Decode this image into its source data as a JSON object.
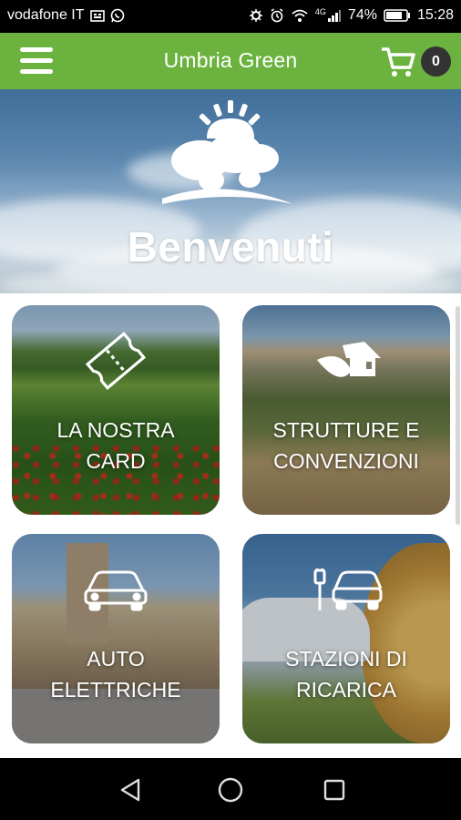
{
  "status_bar": {
    "carrier": "vodafone IT",
    "battery": "74%",
    "time": "15:28",
    "network": "4G"
  },
  "app_bar": {
    "title": "Umbria Green",
    "cart_count": "0",
    "accent_color": "#6bb33e"
  },
  "hero": {
    "title": "Benvenuti"
  },
  "tiles": [
    {
      "label": "LA NOSTRA\nCARD",
      "icon": "ticket-icon"
    },
    {
      "label": "STRUTTURE E\nCONVENZIONI",
      "icon": "house-leaf-icon"
    },
    {
      "label": "AUTO\nELETTRICHE",
      "icon": "car-icon"
    },
    {
      "label": "STAZIONI DI\nRICARICA",
      "icon": "charging-station-icon"
    }
  ],
  "nav_bar": {
    "back": "back-icon",
    "home": "home-icon",
    "recents": "recents-icon"
  }
}
